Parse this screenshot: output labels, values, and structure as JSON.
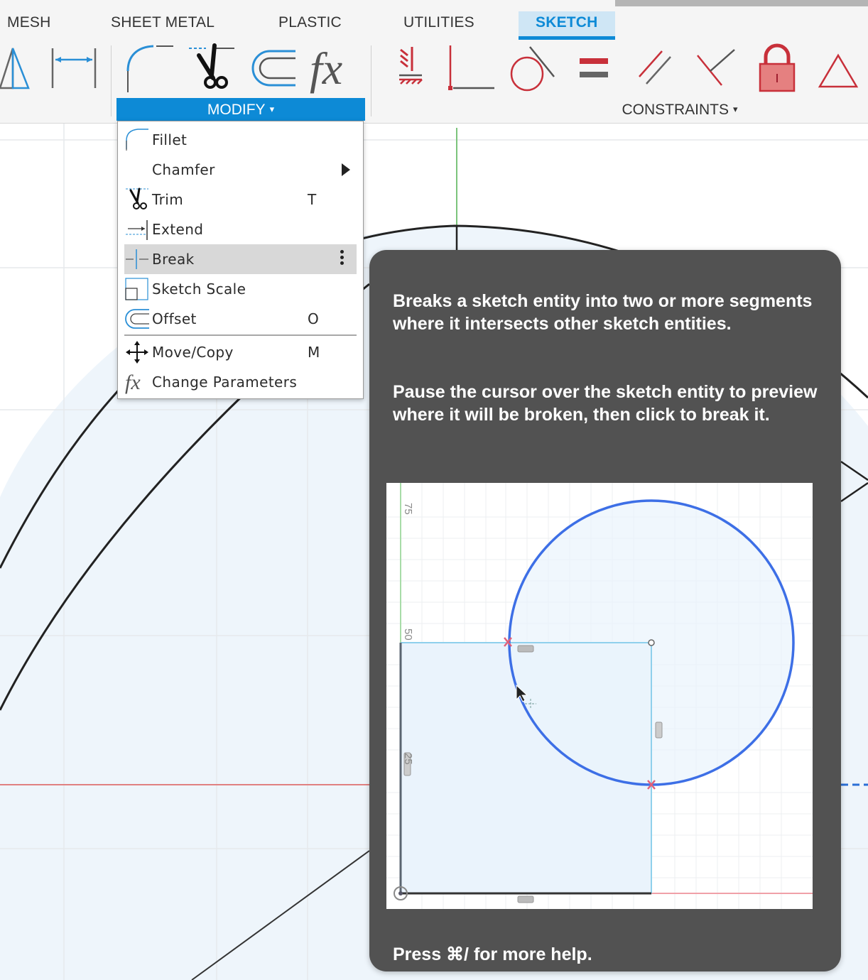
{
  "toolbar": {
    "tabs": [
      {
        "label": "MESH",
        "active": false
      },
      {
        "label": "SHEET METAL",
        "active": false
      },
      {
        "label": "PLASTIC",
        "active": false
      },
      {
        "label": "UTILITIES",
        "active": false
      },
      {
        "label": "SKETCH",
        "active": true
      }
    ],
    "groups": {
      "modify": {
        "label": "MODIFY",
        "caret": "▾",
        "open": true
      },
      "constraints": {
        "label": "CONSTRAINTS",
        "caret": "▾"
      }
    },
    "tools": {
      "modify": [
        "fillet-icon",
        "trim-icon",
        "offset-icon",
        "change-parameters-icon"
      ],
      "left": [
        "mirror-icon",
        "dimension-icon"
      ],
      "constraints": [
        "fix-constraint-icon",
        "coincident-constraint-icon",
        "tangent-constraint-icon",
        "equal-constraint-icon",
        "parallel-constraint-icon",
        "perpendicular-constraint-icon",
        "lock-icon",
        "triangle-constraint-icon"
      ]
    },
    "accent_color": "#0d8ad6",
    "constraint_color": "#c8303a"
  },
  "modify_menu": {
    "items": [
      {
        "label": "Fillet",
        "shortcut": "",
        "icon": "fillet-icon"
      },
      {
        "label": "Chamfer",
        "shortcut": "",
        "icon": "",
        "submenu": true
      },
      {
        "label": "Trim",
        "shortcut": "T",
        "icon": "trim-icon"
      },
      {
        "label": "Extend",
        "shortcut": "",
        "icon": "extend-icon"
      },
      {
        "label": "Break",
        "shortcut": "",
        "icon": "break-icon",
        "hovered": true,
        "more": true
      },
      {
        "label": "Sketch Scale",
        "shortcut": "",
        "icon": "sketch-scale-icon"
      },
      {
        "label": "Offset",
        "shortcut": "O",
        "icon": "offset-icon"
      },
      {
        "label": "Move/Copy",
        "shortcut": "M",
        "icon": "move-icon"
      },
      {
        "label": "Change Parameters",
        "shortcut": "",
        "icon": "change-parameters-icon"
      }
    ]
  },
  "tooltip": {
    "paragraph1": "Breaks a sketch entity into two or more segments where it intersects other sketch entities.",
    "paragraph2": "Pause the cursor over the sketch entity to preview where it will be broken, then click to break it.",
    "footer": "Press ⌘/ for more help.",
    "preview": {
      "axis_labels": [
        "75",
        "50",
        "25"
      ]
    }
  }
}
